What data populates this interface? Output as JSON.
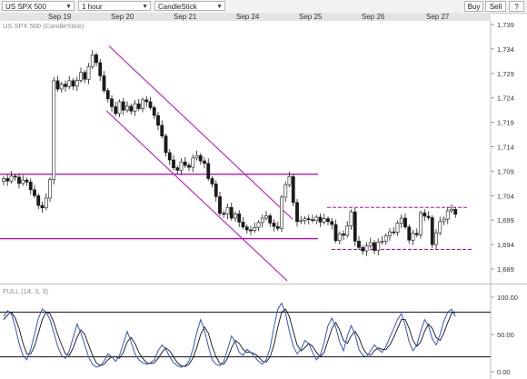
{
  "toolbar": {
    "symbol": "US SPX 500",
    "timeframe": "1 hour",
    "chart_style": "CandleStick",
    "buy_label": "Buy",
    "sell_label": "Sell",
    "more_label": "?"
  },
  "price_panel": {
    "title": "US SPX 500 (CandleStick)",
    "y_ticks": [
      "1,739",
      "1,734",
      "1,729",
      "1,724",
      "1,719",
      "1,714",
      "1,709",
      "1,704",
      "1,699",
      "1,694",
      "1,689"
    ]
  },
  "oscillator_panel": {
    "title": "FULL (14, 3, 3)",
    "y_ticks": [
      "100.00",
      "50.00",
      "0.00"
    ]
  },
  "date_labels": [
    "Sep 19",
    "Sep 20",
    "Sep 21",
    "Sep 24",
    "Sep 25",
    "Sep 26",
    "Sep 27"
  ],
  "colors": {
    "up_candle": "#ffffff",
    "down_candle": "#1a1a1a",
    "trendline": "#c000c0",
    "stochastic_k": "#3355cc",
    "stochastic_d": "#111111"
  },
  "chart_data": [
    {
      "type": "candlestick",
      "title": "US SPX 500 (CandleStick)",
      "x_categories": [
        "Sep 19",
        "Sep 20",
        "Sep 21",
        "Sep 24",
        "Sep 25",
        "Sep 26",
        "Sep 27"
      ],
      "ylim": [
        1686,
        1740
      ],
      "grid": false,
      "close": [
        1707.5,
        1707,
        1708,
        1707.8,
        1706.5,
        1707.2,
        1706.8,
        1705.2,
        1704,
        1702,
        1701.5,
        1703.5,
        1707.3,
        1727.5,
        1725.8,
        1726.8,
        1726.3,
        1727.5,
        1726.4,
        1727.6,
        1729.2,
        1727.8,
        1730.4,
        1732.8,
        1731.2,
        1728.5,
        1725.5,
        1723.8,
        1722.2,
        1720.8,
        1723.2,
        1721.5,
        1722.3,
        1721.3,
        1722.8,
        1721.8,
        1723.6,
        1723.2,
        1722,
        1720.4,
        1718.4,
        1716.2,
        1712.8,
        1711.3,
        1709.7,
        1709.2,
        1710.9,
        1710.2,
        1709.8,
        1711.7,
        1712.2,
        1711.1,
        1710.6,
        1707.5,
        1706.4,
        1703.8,
        1700.4,
        1700.2,
        1701.6,
        1699.4,
        1700.3,
        1698.6,
        1697.6,
        1697,
        1696.9,
        1697.5,
        1698.5,
        1699.4,
        1699.9,
        1698.4,
        1697.7,
        1697.3,
        1703.7,
        1706.2,
        1707.9,
        1702.6,
        1698.7,
        1698.9,
        1699.3,
        1699.1,
        1698.9,
        1699.6,
        1698.6,
        1699.3,
        1698.7,
        1698.1,
        1694.8,
        1696.2,
        1695.9,
        1697.8,
        1700.7,
        1694.7,
        1693.4,
        1692.7,
        1693.7,
        1694.4,
        1692.8,
        1694.5,
        1694.7,
        1695.8,
        1696.6,
        1696.5,
        1698.4,
        1699.4,
        1697.6,
        1694.9,
        1696.3,
        1696,
        1700.5,
        1699.8,
        1699.5,
        1694,
        1696.4,
        1698.7,
        1699.2,
        1700.9,
        1701.2,
        1700.2
      ]
    },
    {
      "type": "line",
      "title": "FULL (14, 3, 3)",
      "ylim": [
        0,
        100
      ],
      "y_ticks": [
        100,
        50,
        0
      ],
      "reference_levels": [
        80,
        20
      ],
      "series": [
        {
          "name": "%K",
          "values": [
            74,
            82,
            78,
            60,
            38,
            22,
            16,
            30,
            50,
            72,
            84,
            80,
            70,
            52,
            34,
            22,
            18,
            28,
            46,
            64,
            52,
            36,
            20,
            10,
            6,
            8,
            14,
            24,
            20,
            14,
            22,
            38,
            54,
            40,
            24,
            16,
            12,
            10,
            12,
            16,
            28,
            36,
            30,
            20,
            12,
            8,
            6,
            8,
            14,
            30,
            52,
            70,
            56,
            34,
            16,
            10,
            8,
            14,
            30,
            48,
            40,
            26,
            22,
            30,
            26,
            20,
            14,
            10,
            16,
            32,
            60,
            84,
            92,
            78,
            54,
            34,
            24,
            30,
            42,
            38,
            26,
            16,
            22,
            40,
            62,
            72,
            60,
            40,
            28,
            48,
            62,
            50,
            30,
            22,
            20,
            28,
            36,
            30,
            26,
            34,
            46,
            58,
            70,
            78,
            62,
            40,
            28,
            36,
            54,
            70,
            62,
            44,
            36,
            50,
            68,
            80,
            84,
            74
          ]
        },
        {
          "name": "%D",
          "values": [
            70,
            76,
            80,
            72,
            58,
            38,
            24,
            24,
            34,
            52,
            70,
            80,
            78,
            66,
            50,
            36,
            24,
            22,
            32,
            46,
            56,
            50,
            36,
            22,
            12,
            8,
            10,
            16,
            20,
            20,
            18,
            26,
            40,
            46,
            38,
            26,
            18,
            12,
            11,
            12,
            18,
            26,
            32,
            28,
            20,
            12,
            8,
            7,
            10,
            18,
            32,
            50,
            60,
            52,
            34,
            20,
            11,
            10,
            18,
            32,
            42,
            38,
            30,
            26,
            26,
            24,
            20,
            14,
            13,
            20,
            36,
            60,
            80,
            84,
            74,
            54,
            36,
            28,
            32,
            38,
            34,
            26,
            20,
            26,
            42,
            58,
            66,
            56,
            42,
            38,
            48,
            54,
            46,
            32,
            24,
            22,
            28,
            32,
            30,
            30,
            36,
            46,
            58,
            70,
            70,
            58,
            42,
            34,
            40,
            54,
            64,
            58,
            46,
            42,
            52,
            66,
            78,
            80
          ]
        }
      ]
    }
  ]
}
